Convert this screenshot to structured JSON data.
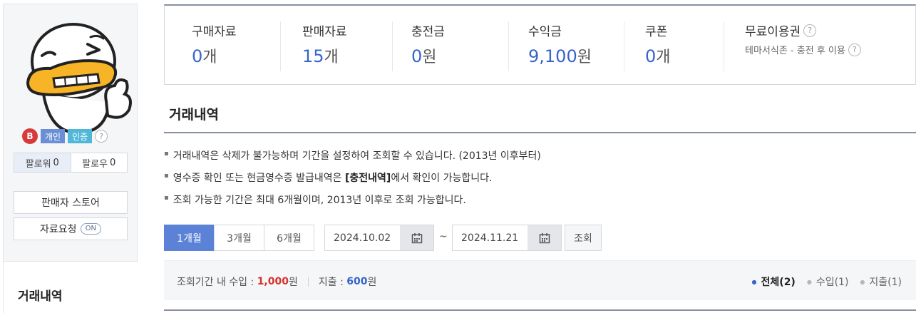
{
  "sidebar": {
    "grade_badge": "B",
    "tags": [
      "개인",
      "인증"
    ],
    "help_glyph": "?",
    "followers_label": "팔로워",
    "followers_count": "0",
    "following_label": "팔로우",
    "following_count": "0",
    "store_button": "판매자 스토어",
    "request_button": "자료요청",
    "request_toggle": "ON",
    "menu_title": "거래내역"
  },
  "stats": [
    {
      "label": "구매자료",
      "value": "0",
      "unit": "개"
    },
    {
      "label": "판매자료",
      "value": "15",
      "unit": "개"
    },
    {
      "label": "충전금",
      "value": "0",
      "unit": "원"
    },
    {
      "label": "수익금",
      "value": "9,100",
      "unit": "원"
    },
    {
      "label": "쿠폰",
      "value": "0",
      "unit": "개"
    }
  ],
  "free_pass": {
    "label": "무료이용권",
    "note": "테마서식존 - 충전 후 이용"
  },
  "section": {
    "title": "거래내역",
    "notices": [
      "거래내역은 삭제가 불가능하며 기간을 설정하여 조회할 수 있습니다. (2013년 이후부터)",
      "영수증 확인 또는 현금영수증 발급내역은",
      "조회 가능한 기간은 최대 6개월이며, 2013년 이후로 조회 가능합니다."
    ],
    "notice2_bold": "[충전내역]",
    "notice2_tail": "에서 확인이 가능합니다."
  },
  "filter": {
    "periods": [
      "1개월",
      "3개월",
      "6개월"
    ],
    "active_period": "1개월",
    "start_date": "2024.10.02",
    "end_date": "2024.11.21",
    "tilde": "~",
    "search_label": "조회"
  },
  "summary": {
    "income_label": "조회기간 내 수입 :",
    "income_value": "1,000",
    "income_unit": "원",
    "expense_label": "지출 :",
    "expense_value": "600",
    "expense_unit": "원",
    "tabs": [
      "전체(2)",
      "수입(1)",
      "지출(1)"
    ],
    "active_tab": "전체(2)"
  },
  "colors": {
    "accent": "#5b82d6",
    "value_blue": "#3764c9",
    "income_red": "#d6322b"
  }
}
